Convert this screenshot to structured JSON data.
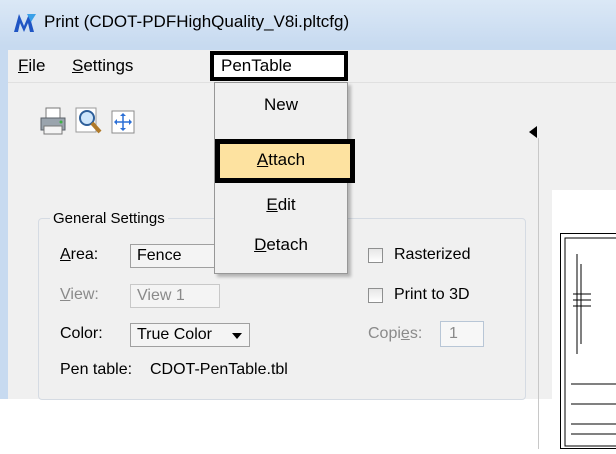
{
  "window": {
    "title": "Print  (CDOT-PDFHighQuality_V8i.pltcfg)"
  },
  "menubar": {
    "file": {
      "underline": "F",
      "rest": "ile"
    },
    "settings": {
      "underline": "S",
      "rest": "ettings"
    },
    "pentable": "PenTable"
  },
  "toolbar": {
    "icons": [
      "printer-icon",
      "preview-magnifier-icon",
      "fit-area-icon"
    ]
  },
  "general_settings": {
    "group_label": "General Settings",
    "area_label_u": "A",
    "area_label_rest": "rea:",
    "area_value": "Fence",
    "view_label_u": "V",
    "view_label_rest": "iew:",
    "view_value": "View 1",
    "color_label": "Color:",
    "color_value": "True Color",
    "copies_label_pre": "Copi",
    "copies_label_u": "e",
    "copies_label_post": "s:",
    "copies_value": "1",
    "rasterized_label": "Rasterized",
    "print3d_label": "Print to 3D",
    "pen_table_label": "Pen table:",
    "pen_table_value": "CDOT-PenTable.tbl"
  },
  "pentable_menu": {
    "new": "New",
    "attach_u": "A",
    "attach_rest": "ttach",
    "edit_u": "E",
    "edit_rest": "dit",
    "detach_u": "D",
    "detach_rest": "etach"
  },
  "colors": {
    "highlight": "#fde2a0",
    "title_gradient_top": "#dbe8f6",
    "title_gradient_bottom": "#c7daf0"
  }
}
